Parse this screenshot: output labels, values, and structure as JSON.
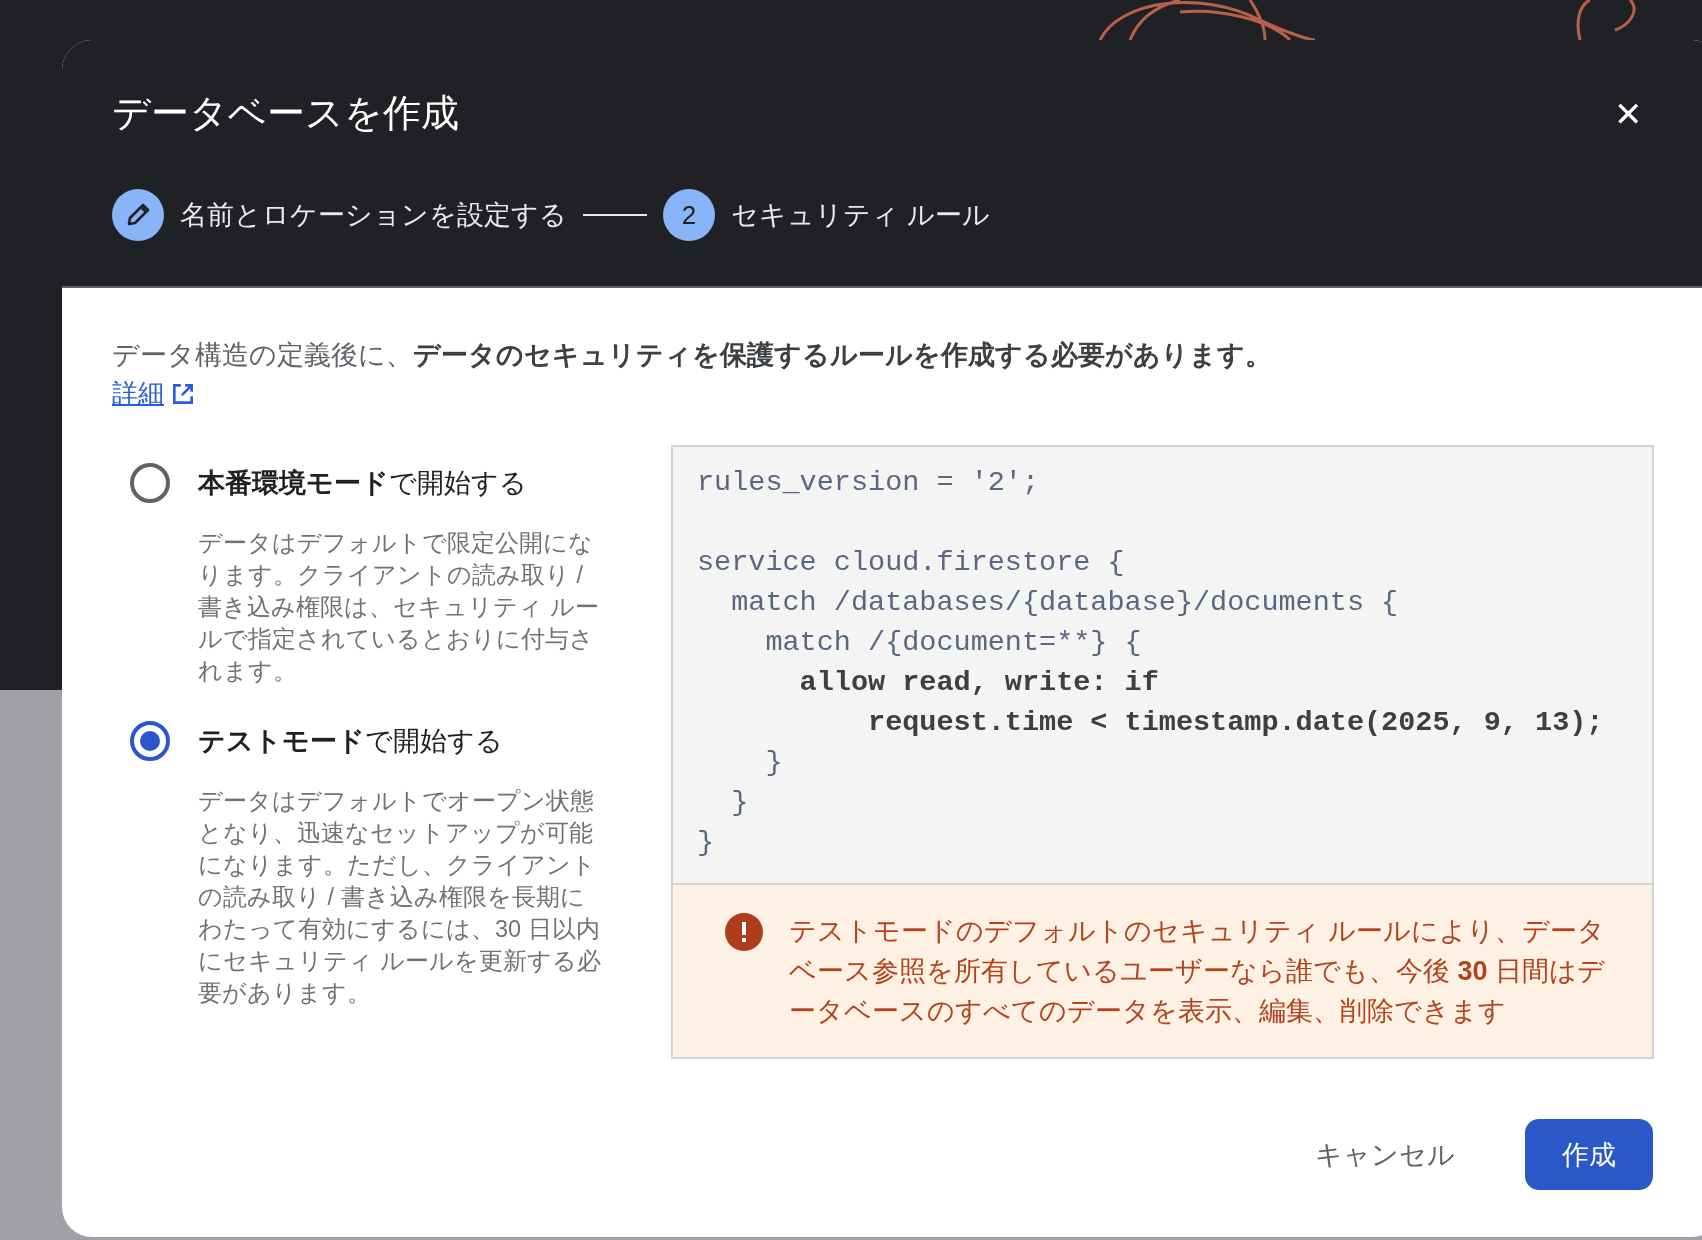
{
  "dialog": {
    "title": "データベースを作成",
    "close": "✕",
    "steps": [
      {
        "kind": "done",
        "label": "名前とロケーションを設定する"
      },
      {
        "kind": "current",
        "number": "2",
        "label": "セキュリティ ルール"
      }
    ],
    "intro": "データ構造の定義後に、**データのセキュリティを保護するルールを作成する必要があります。**",
    "learn_more": "詳細",
    "modes": [
      {
        "label": "**本番環境モード**で開始する",
        "description": "データはデフォルトで限定公開になります。クライアントの読み取り / 書き込み権限は、セキュリティ ルールで指定されているとおりに付与されます。",
        "selected": false
      },
      {
        "label": "**テストモード**で開始する",
        "description": "データはデフォルトでオープン状態となり、迅速なセットアップが可能になります。ただし、クライアントの読み取り / 書き込み権限を長期にわたって有効にするには、30 日以内にセキュリティ ルールを更新する必要があります。",
        "selected": true
      }
    ],
    "code": [
      {
        "text": "rules_version = '2';",
        "bold": false
      },
      {
        "kind": "blank"
      },
      {
        "text": "service cloud.firestore {",
        "bold": false
      },
      {
        "text": "  match /databases/{database}/documents {",
        "bold": false
      },
      {
        "text": "    match /{document=**} {",
        "bold": false
      },
      {
        "text": "      allow read, write: if",
        "bold": true
      },
      {
        "text": "          request.time < timestamp.date(2025, 9, 13);",
        "bold": true
      },
      {
        "text": "    }",
        "bold": false
      },
      {
        "text": "  }",
        "bold": false
      },
      {
        "text": "}",
        "bold": false
      }
    ],
    "warning": "テストモードのデフォルトのセキュリティ ルールにより、データベース参照を所有しているユーザーなら誰でも、今後 **30** 日間はデータベースのすべてのデータを表示、編集、削除できます",
    "buttons": [
      {
        "kind": "text",
        "label": "キャンセル"
      },
      {
        "kind": "primary",
        "label": "作成"
      }
    ]
  }
}
